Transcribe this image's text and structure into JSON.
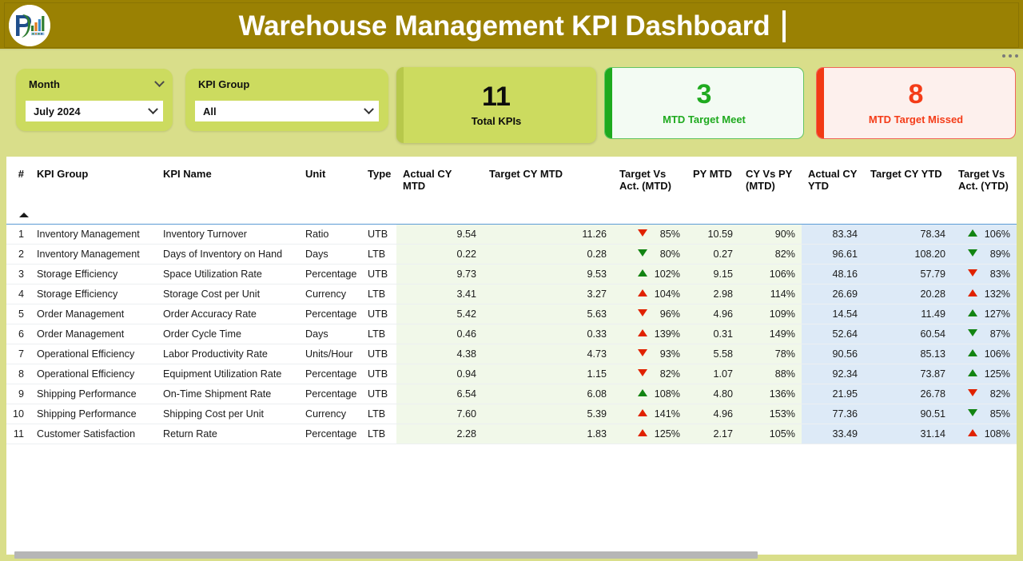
{
  "header": {
    "title": "Warehouse Management KPI Dashboard",
    "logo_alt": "PK analytics logo",
    "bg_color": "#9a8103",
    "title_color": "#ffffff"
  },
  "more_menu": {
    "label": "More options"
  },
  "slicers": [
    {
      "name": "month",
      "label": "Month",
      "value": "July 2024",
      "placeholder": "July 2024"
    },
    {
      "name": "kpi_group",
      "label": "KPI Group",
      "value": "All",
      "placeholder": "All"
    }
  ],
  "cards": [
    {
      "name": "total-kpis",
      "value": "11",
      "label": "Total KPIs",
      "accent": "#b7c84b",
      "bg": "#ccdb5f",
      "fg": "#0c0c0c"
    },
    {
      "name": "mtd-target-meet",
      "value": "3",
      "label": "MTD Target Meet",
      "accent": "#1eaa1e",
      "bg": "#f3fbf3",
      "fg": "#1faa1f"
    },
    {
      "name": "mtd-target-missed",
      "value": "8",
      "label": "MTD Target Missed",
      "accent": "#f23a14",
      "bg": "#fdf0ed",
      "fg": "#f43c18"
    }
  ],
  "table": {
    "sort_column": "#",
    "sort_direction": "ascending",
    "headers": {
      "index": "#",
      "kpi_group": "KPI Group",
      "kpi_name": "KPI Name",
      "unit": "Unit",
      "type": "Type",
      "actual_cy_mtd": "Actual CY MTD",
      "target_cy_mtd": "Target CY MTD",
      "target_vs_act_mtd": "Target Vs Act. (MTD)",
      "py_mtd": "PY MTD",
      "cy_vs_py_mtd": "CY Vs PY (MTD)",
      "actual_cy_ytd": "Actual CY YTD",
      "target_cy_ytd": "Target CY YTD",
      "target_vs_act_ytd": "Target Vs Act. (YTD)"
    },
    "rows": [
      {
        "index": "1",
        "kpi_group": "Inventory Management",
        "kpi_name": "Inventory Turnover",
        "unit": "Ratio",
        "type": "UTB",
        "actual_cy_mtd": "9.54",
        "target_cy_mtd": "11.26",
        "target_vs_act_mtd": "85%",
        "tva_mtd_dir": "down",
        "tva_mtd_color": "r",
        "py_mtd": "10.59",
        "cy_vs_py_mtd": "90%",
        "actual_cy_ytd": "83.34",
        "target_cy_ytd": "78.34",
        "target_vs_act_ytd": "106%",
        "tva_ytd_dir": "up",
        "tva_ytd_color": "g"
      },
      {
        "index": "2",
        "kpi_group": "Inventory Management",
        "kpi_name": "Days of Inventory on Hand",
        "unit": "Days",
        "type": "LTB",
        "actual_cy_mtd": "0.22",
        "target_cy_mtd": "0.28",
        "target_vs_act_mtd": "80%",
        "tva_mtd_dir": "down",
        "tva_mtd_color": "g",
        "py_mtd": "0.27",
        "cy_vs_py_mtd": "82%",
        "actual_cy_ytd": "96.61",
        "target_cy_ytd": "108.20",
        "target_vs_act_ytd": "89%",
        "tva_ytd_dir": "down",
        "tva_ytd_color": "g"
      },
      {
        "index": "3",
        "kpi_group": "Storage Efficiency",
        "kpi_name": "Space Utilization Rate",
        "unit": "Percentage",
        "type": "UTB",
        "actual_cy_mtd": "9.73",
        "target_cy_mtd": "9.53",
        "target_vs_act_mtd": "102%",
        "tva_mtd_dir": "up",
        "tva_mtd_color": "g",
        "py_mtd": "9.15",
        "cy_vs_py_mtd": "106%",
        "actual_cy_ytd": "48.16",
        "target_cy_ytd": "57.79",
        "target_vs_act_ytd": "83%",
        "tva_ytd_dir": "down",
        "tva_ytd_color": "r"
      },
      {
        "index": "4",
        "kpi_group": "Storage Efficiency",
        "kpi_name": "Storage Cost per Unit",
        "unit": "Currency",
        "type": "LTB",
        "actual_cy_mtd": "3.41",
        "target_cy_mtd": "3.27",
        "target_vs_act_mtd": "104%",
        "tva_mtd_dir": "up",
        "tva_mtd_color": "r",
        "py_mtd": "2.98",
        "cy_vs_py_mtd": "114%",
        "actual_cy_ytd": "26.69",
        "target_cy_ytd": "20.28",
        "target_vs_act_ytd": "132%",
        "tva_ytd_dir": "up",
        "tva_ytd_color": "r"
      },
      {
        "index": "5",
        "kpi_group": "Order Management",
        "kpi_name": "Order Accuracy Rate",
        "unit": "Percentage",
        "type": "UTB",
        "actual_cy_mtd": "5.42",
        "target_cy_mtd": "5.63",
        "target_vs_act_mtd": "96%",
        "tva_mtd_dir": "down",
        "tva_mtd_color": "r",
        "py_mtd": "4.96",
        "cy_vs_py_mtd": "109%",
        "actual_cy_ytd": "14.54",
        "target_cy_ytd": "11.49",
        "target_vs_act_ytd": "127%",
        "tva_ytd_dir": "up",
        "tva_ytd_color": "g"
      },
      {
        "index": "6",
        "kpi_group": "Order Management",
        "kpi_name": "Order Cycle Time",
        "unit": "Days",
        "type": "LTB",
        "actual_cy_mtd": "0.46",
        "target_cy_mtd": "0.33",
        "target_vs_act_mtd": "139%",
        "tva_mtd_dir": "up",
        "tva_mtd_color": "r",
        "py_mtd": "0.31",
        "cy_vs_py_mtd": "149%",
        "actual_cy_ytd": "52.64",
        "target_cy_ytd": "60.54",
        "target_vs_act_ytd": "87%",
        "tva_ytd_dir": "down",
        "tva_ytd_color": "g"
      },
      {
        "index": "7",
        "kpi_group": "Operational Efficiency",
        "kpi_name": "Labor Productivity Rate",
        "unit": "Units/Hour",
        "type": "UTB",
        "actual_cy_mtd": "4.38",
        "target_cy_mtd": "4.73",
        "target_vs_act_mtd": "93%",
        "tva_mtd_dir": "down",
        "tva_mtd_color": "r",
        "py_mtd": "5.58",
        "cy_vs_py_mtd": "78%",
        "actual_cy_ytd": "90.56",
        "target_cy_ytd": "85.13",
        "target_vs_act_ytd": "106%",
        "tva_ytd_dir": "up",
        "tva_ytd_color": "g"
      },
      {
        "index": "8",
        "kpi_group": "Operational Efficiency",
        "kpi_name": "Equipment Utilization Rate",
        "unit": "Percentage",
        "type": "UTB",
        "actual_cy_mtd": "0.94",
        "target_cy_mtd": "1.15",
        "target_vs_act_mtd": "82%",
        "tva_mtd_dir": "down",
        "tva_mtd_color": "r",
        "py_mtd": "1.07",
        "cy_vs_py_mtd": "88%",
        "actual_cy_ytd": "92.34",
        "target_cy_ytd": "73.87",
        "target_vs_act_ytd": "125%",
        "tva_ytd_dir": "up",
        "tva_ytd_color": "g"
      },
      {
        "index": "9",
        "kpi_group": "Shipping Performance",
        "kpi_name": "On-Time Shipment Rate",
        "unit": "Percentage",
        "type": "UTB",
        "actual_cy_mtd": "6.54",
        "target_cy_mtd": "6.08",
        "target_vs_act_mtd": "108%",
        "tva_mtd_dir": "up",
        "tva_mtd_color": "g",
        "py_mtd": "4.80",
        "cy_vs_py_mtd": "136%",
        "actual_cy_ytd": "21.95",
        "target_cy_ytd": "26.78",
        "target_vs_act_ytd": "82%",
        "tva_ytd_dir": "down",
        "tva_ytd_color": "r"
      },
      {
        "index": "10",
        "kpi_group": "Shipping Performance",
        "kpi_name": "Shipping Cost per Unit",
        "unit": "Currency",
        "type": "LTB",
        "actual_cy_mtd": "7.60",
        "target_cy_mtd": "5.39",
        "target_vs_act_mtd": "141%",
        "tva_mtd_dir": "up",
        "tva_mtd_color": "r",
        "py_mtd": "4.96",
        "cy_vs_py_mtd": "153%",
        "actual_cy_ytd": "77.36",
        "target_cy_ytd": "90.51",
        "target_vs_act_ytd": "85%",
        "tva_ytd_dir": "down",
        "tva_ytd_color": "g"
      },
      {
        "index": "11",
        "kpi_group": "Customer Satisfaction",
        "kpi_name": "Return Rate",
        "unit": "Percentage",
        "type": "LTB",
        "actual_cy_mtd": "2.28",
        "target_cy_mtd": "1.83",
        "target_vs_act_mtd": "125%",
        "tva_mtd_dir": "up",
        "tva_mtd_color": "r",
        "py_mtd": "2.17",
        "cy_vs_py_mtd": "105%",
        "actual_cy_ytd": "33.49",
        "target_cy_ytd": "31.14",
        "target_vs_act_ytd": "108%",
        "tva_ytd_dir": "up",
        "tva_ytd_color": "r"
      }
    ]
  },
  "chart_data": {
    "type": "table",
    "title": "Warehouse Management KPI Dashboard",
    "categories": [
      "Inventory Turnover",
      "Days of Inventory on Hand",
      "Space Utilization Rate",
      "Storage Cost per Unit",
      "Order Accuracy Rate",
      "Order Cycle Time",
      "Labor Productivity Rate",
      "Equipment Utilization Rate",
      "On-Time Shipment Rate",
      "Shipping Cost per Unit",
      "Return Rate"
    ],
    "series": [
      {
        "name": "Actual CY MTD",
        "values": [
          9.54,
          0.22,
          9.73,
          3.41,
          5.42,
          0.46,
          4.38,
          0.94,
          6.54,
          7.6,
          2.28
        ]
      },
      {
        "name": "Target CY MTD",
        "values": [
          11.26,
          0.28,
          9.53,
          3.27,
          5.63,
          0.33,
          4.73,
          1.15,
          6.08,
          5.39,
          1.83
        ]
      },
      {
        "name": "Target Vs Act. (MTD) %",
        "values": [
          85,
          80,
          102,
          104,
          96,
          139,
          93,
          82,
          108,
          141,
          125
        ]
      },
      {
        "name": "PY MTD",
        "values": [
          10.59,
          0.27,
          9.15,
          2.98,
          4.96,
          0.31,
          5.58,
          1.07,
          4.8,
          4.96,
          2.17
        ]
      },
      {
        "name": "CY Vs PY (MTD) %",
        "values": [
          90,
          82,
          106,
          114,
          109,
          149,
          78,
          88,
          136,
          153,
          105
        ]
      },
      {
        "name": "Actual CY YTD",
        "values": [
          83.34,
          96.61,
          48.16,
          26.69,
          14.54,
          52.64,
          90.56,
          92.34,
          21.95,
          77.36,
          33.49
        ]
      },
      {
        "name": "Target CY YTD",
        "values": [
          78.34,
          108.2,
          57.79,
          20.28,
          11.49,
          60.54,
          85.13,
          73.87,
          26.78,
          90.51,
          31.14
        ]
      },
      {
        "name": "Target Vs Act. (YTD) %",
        "values": [
          106,
          89,
          83,
          132,
          127,
          87,
          106,
          125,
          82,
          85,
          108
        ]
      }
    ],
    "summary": {
      "total_kpis": 11,
      "mtd_target_meet": 3,
      "mtd_target_missed": 8
    },
    "xlabel": "KPI Name",
    "ylabel": "",
    "grid": true,
    "legend": "none"
  }
}
